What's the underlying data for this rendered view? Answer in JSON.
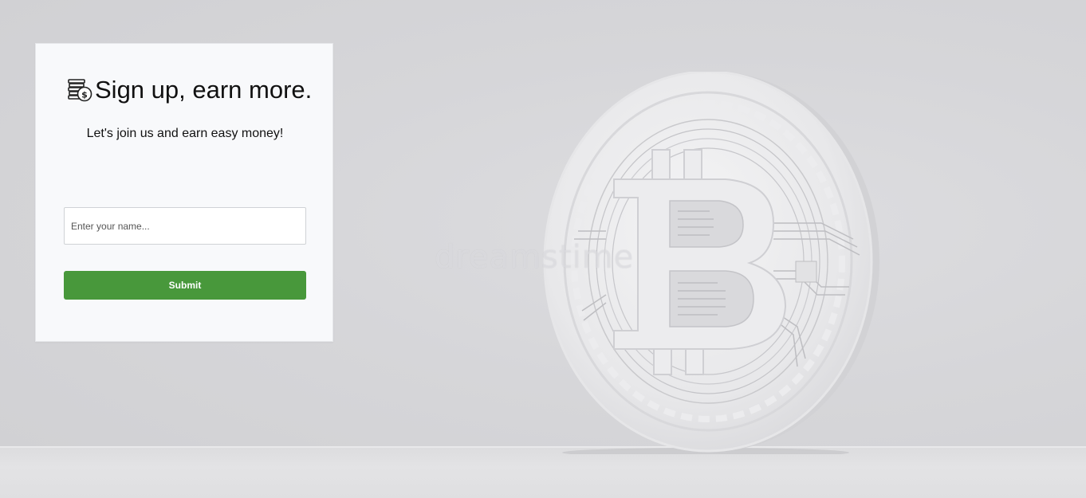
{
  "signup": {
    "title": "Sign up, earn more.",
    "subtitle": "Let's join us and earn easy money!",
    "name_placeholder": "Enter your name...",
    "submit_label": "Submit",
    "icon": "money-coins-icon"
  },
  "background": {
    "image": "bitcoin-coin-illustration",
    "watermark": "dreamstime"
  },
  "colors": {
    "submit_button": "#48983b",
    "card_background": "#f8f9fb"
  }
}
